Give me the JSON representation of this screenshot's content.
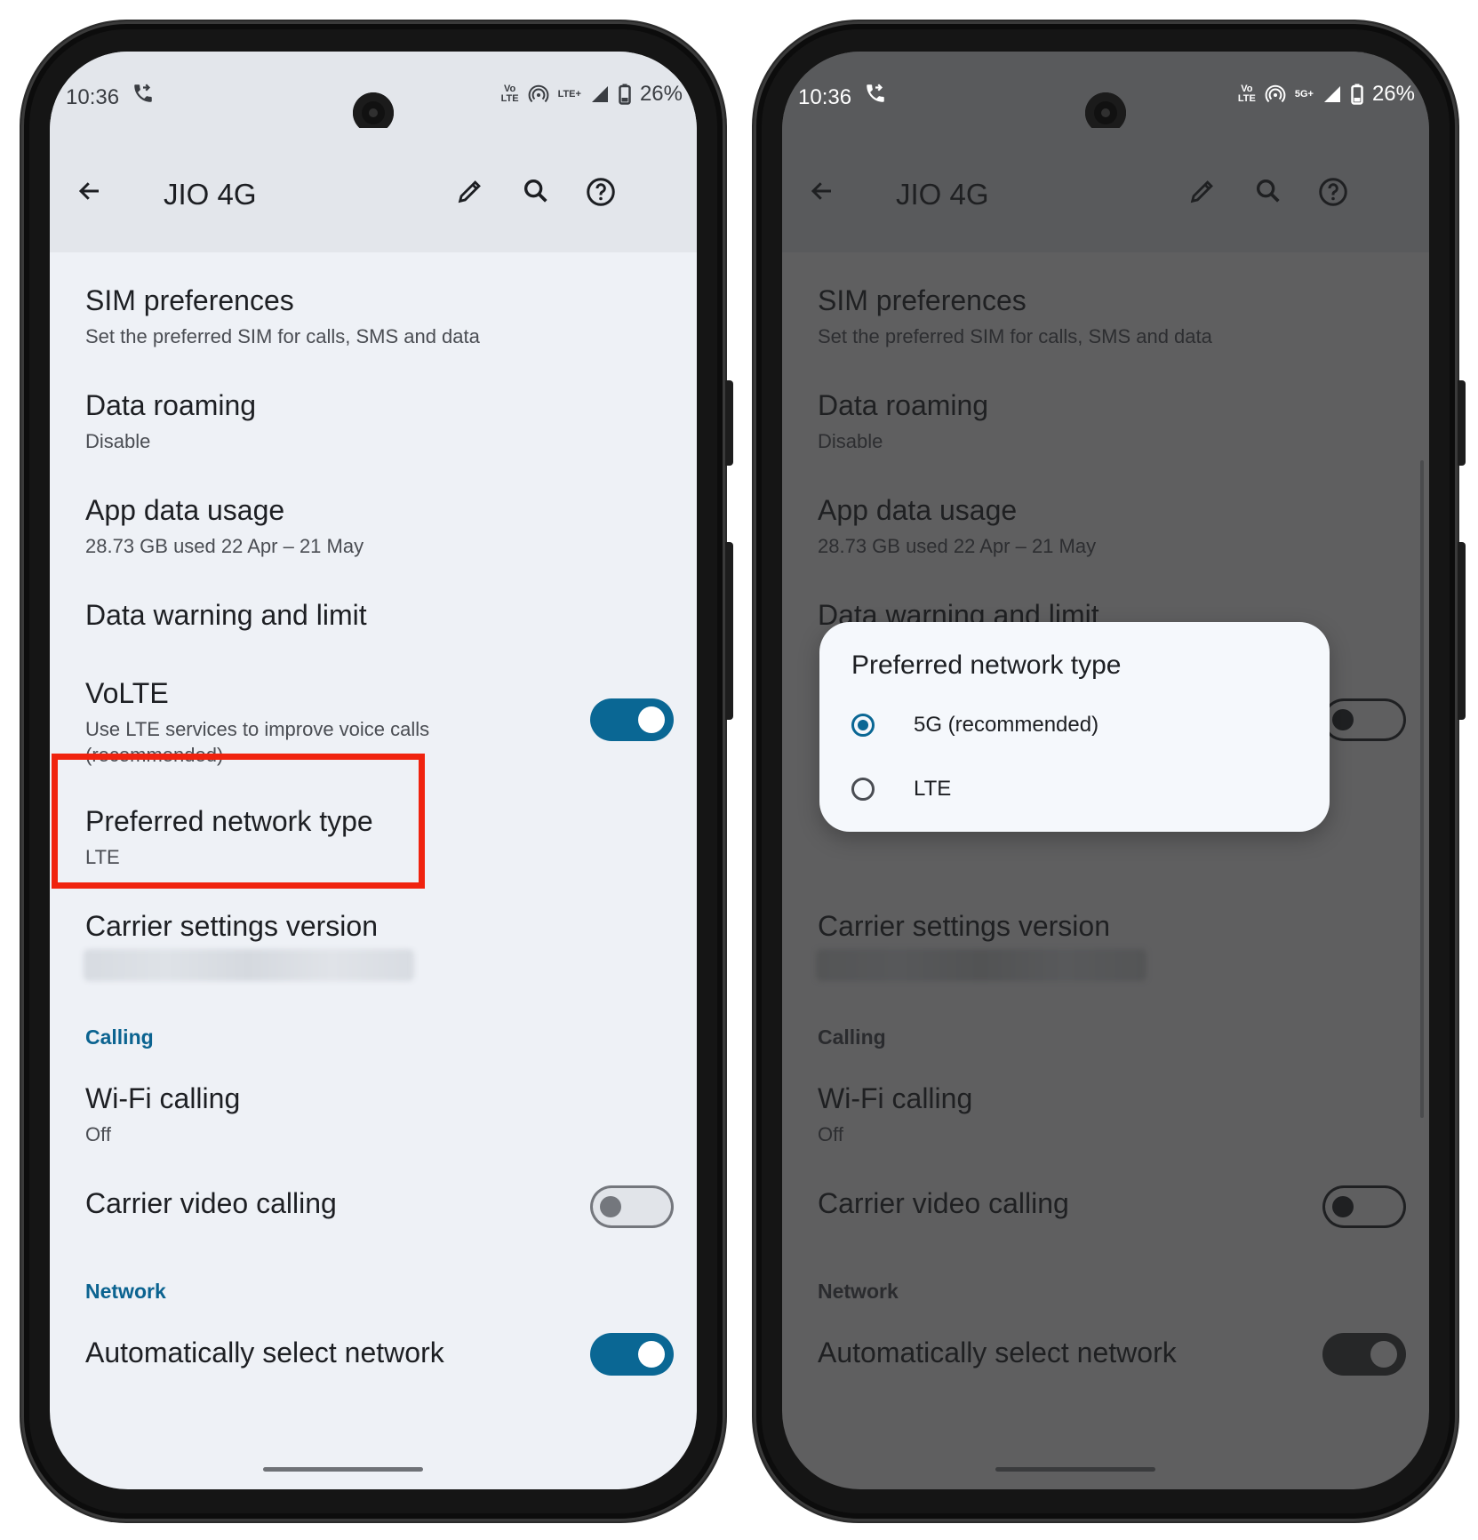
{
  "status": {
    "time": "10:36",
    "left_net": "LTE+",
    "right_net": "5G+",
    "volte_top": "Vo",
    "volte_bottom": "LTE",
    "battery": "26%"
  },
  "appbar": {
    "title": "JIO 4G"
  },
  "items": {
    "sim": {
      "title": "SIM preferences",
      "sub": "Set the preferred SIM for calls, SMS and data"
    },
    "roaming": {
      "title": "Data roaming",
      "sub": "Disable"
    },
    "usage": {
      "title": "App data usage",
      "sub": "28.73 GB used 22 Apr – 21 May"
    },
    "warning": {
      "title": "Data warning and limit"
    },
    "volte": {
      "title": "VoLTE",
      "sub1": "Use LTE services to improve voice calls",
      "sub2": "(recommended)"
    },
    "network_type": {
      "title": "Preferred network type",
      "sub": "LTE"
    },
    "carrier": {
      "title": "Carrier settings version"
    },
    "wifi": {
      "title": "Wi-Fi calling",
      "sub": "Off"
    },
    "video": {
      "title": "Carrier video calling"
    },
    "auto": {
      "title": "Automatically select network"
    }
  },
  "sections": {
    "calling": "Calling",
    "network": "Network"
  },
  "dialog": {
    "title": "Preferred network type",
    "options": [
      {
        "label": "5G (recommended)",
        "selected": true
      },
      {
        "label": "LTE",
        "selected": false
      }
    ]
  },
  "colors": {
    "accent": "#0a6794",
    "highlight": "#f0230f"
  }
}
